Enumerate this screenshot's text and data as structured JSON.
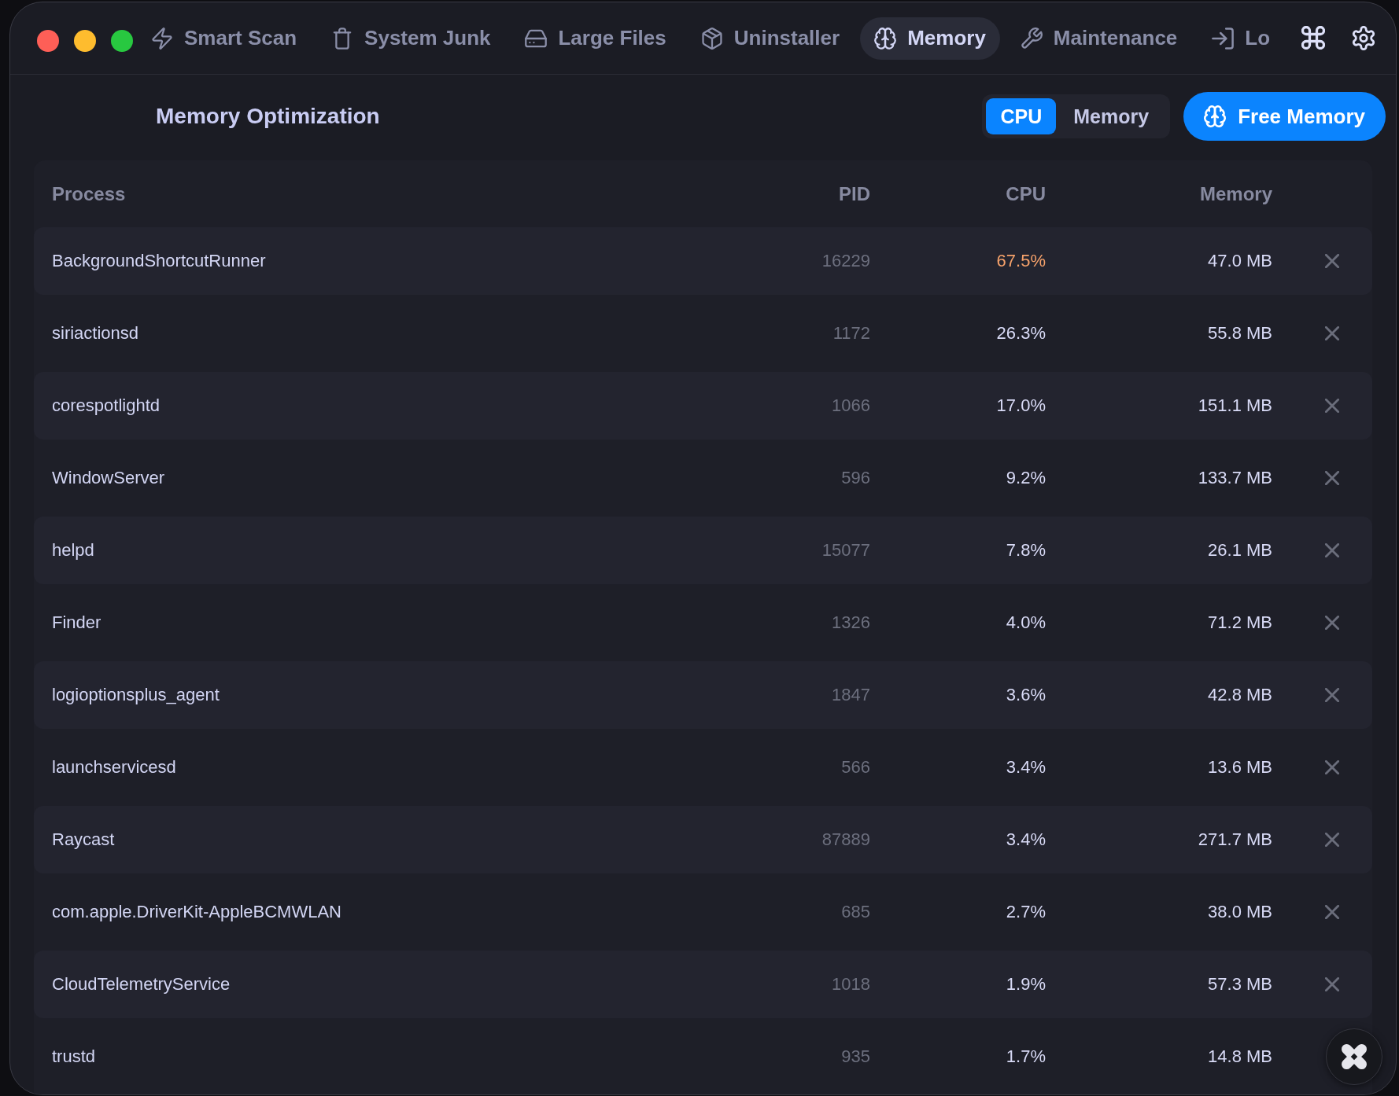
{
  "tabs": [
    {
      "label": "Smart Scan",
      "selected": false
    },
    {
      "label": "System Junk",
      "selected": false
    },
    {
      "label": "Large Files",
      "selected": false
    },
    {
      "label": "Uninstaller",
      "selected": false
    },
    {
      "label": "Memory",
      "selected": true
    },
    {
      "label": "Maintenance",
      "selected": false
    },
    {
      "label": "Lo",
      "selected": false
    }
  ],
  "page": {
    "title": "Memory Optimization"
  },
  "sort_toggle": [
    {
      "label": "CPU",
      "selected": true
    },
    {
      "label": "Memory",
      "selected": false
    }
  ],
  "free_memory_button": {
    "label": "Free Memory"
  },
  "table": {
    "columns": [
      "Process",
      "PID",
      "CPU",
      "Memory"
    ],
    "rows": [
      {
        "process": "BackgroundShortcutRunner",
        "pid": "16229",
        "cpu": "67.5%",
        "memory": "47.0 MB",
        "high_cpu": true
      },
      {
        "process": "siriactionsd",
        "pid": "1172",
        "cpu": "26.3%",
        "memory": "55.8 MB",
        "high_cpu": false
      },
      {
        "process": "corespotlightd",
        "pid": "1066",
        "cpu": "17.0%",
        "memory": "151.1 MB",
        "high_cpu": false
      },
      {
        "process": "WindowServer",
        "pid": "596",
        "cpu": "9.2%",
        "memory": "133.7 MB",
        "high_cpu": false
      },
      {
        "process": "helpd",
        "pid": "15077",
        "cpu": "7.8%",
        "memory": "26.1 MB",
        "high_cpu": false
      },
      {
        "process": "Finder",
        "pid": "1326",
        "cpu": "4.0%",
        "memory": "71.2 MB",
        "high_cpu": false
      },
      {
        "process": "logioptionsplus_agent",
        "pid": "1847",
        "cpu": "3.6%",
        "memory": "42.8 MB",
        "high_cpu": false
      },
      {
        "process": "launchservicesd",
        "pid": "566",
        "cpu": "3.4%",
        "memory": "13.6 MB",
        "high_cpu": false
      },
      {
        "process": "Raycast",
        "pid": "87889",
        "cpu": "3.4%",
        "memory": "271.7 MB",
        "high_cpu": false
      },
      {
        "process": "com.apple.DriverKit-AppleBCMWLAN",
        "pid": "685",
        "cpu": "2.7%",
        "memory": "38.0 MB",
        "high_cpu": false
      },
      {
        "process": "CloudTelemetryService",
        "pid": "1018",
        "cpu": "1.9%",
        "memory": "57.3 MB",
        "high_cpu": false
      },
      {
        "process": "trustd",
        "pid": "935",
        "cpu": "1.7%",
        "memory": "14.8 MB",
        "high_cpu": false
      }
    ]
  }
}
